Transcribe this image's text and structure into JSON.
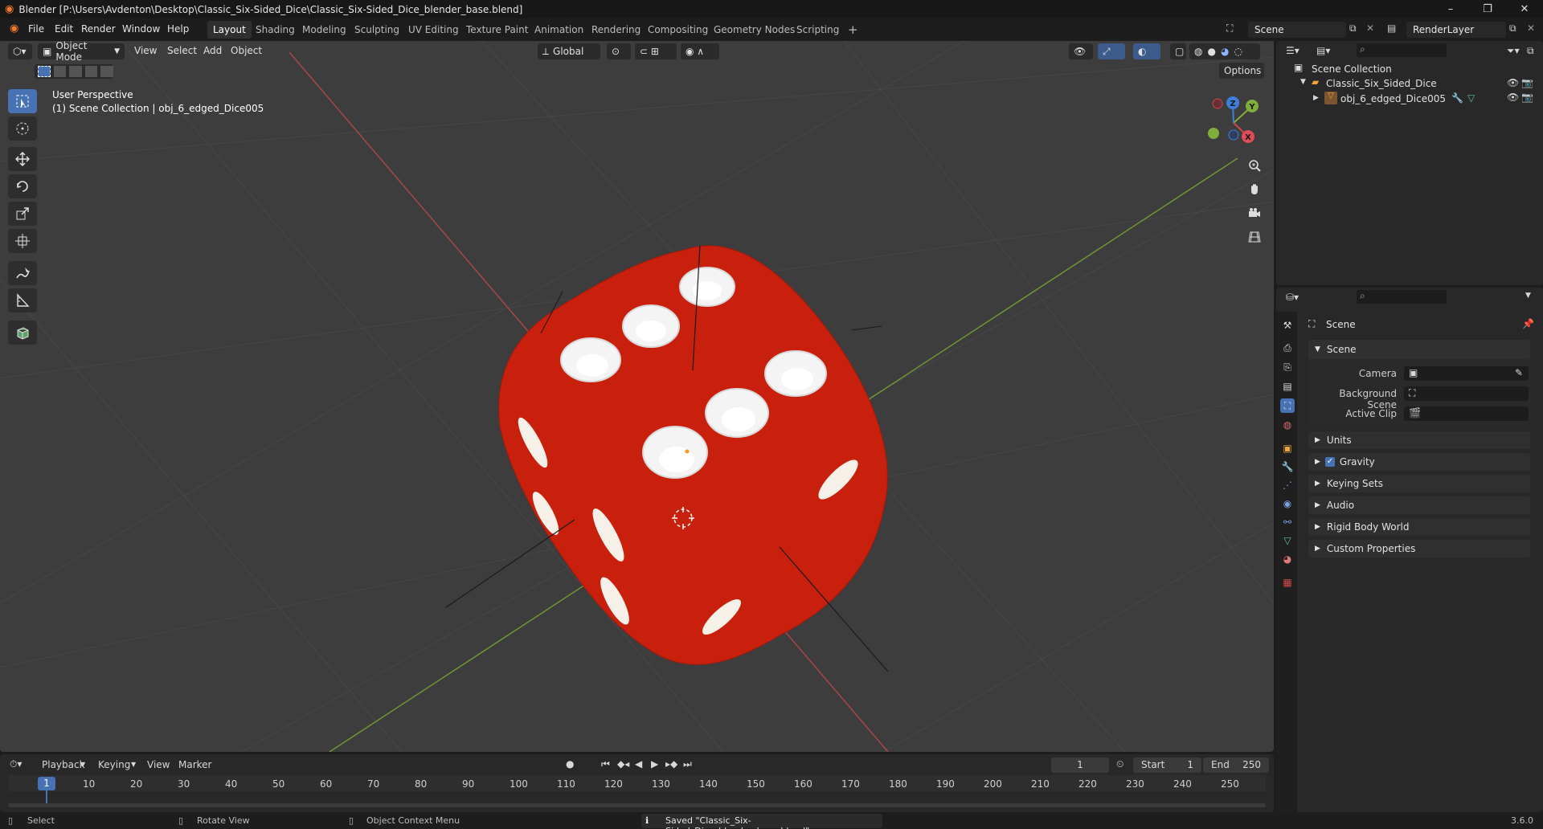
{
  "window": {
    "title": "Blender [P:\\Users\\Avdenton\\Desktop\\Classic_Six-Sided_Dice\\Classic_Six-Sided_Dice_blender_base.blend]"
  },
  "menu": [
    "File",
    "Edit",
    "Render",
    "Window",
    "Help"
  ],
  "workspaces": [
    "Layout",
    "Shading",
    "Modeling",
    "Sculpting",
    "UV Editing",
    "Texture Paint",
    "Animation",
    "Rendering",
    "Compositing",
    "Geometry Nodes",
    "Scripting"
  ],
  "active_workspace": "Layout",
  "topbar_right": {
    "scene": "Scene",
    "view_layer": "RenderLayer"
  },
  "viewport": {
    "mode": "Object Mode",
    "menus": [
      "View",
      "Select",
      "Add",
      "Object"
    ],
    "orientation": "Global",
    "options_label": "Options",
    "info_line1": "User Perspective",
    "info_line2": "(1) Scene Collection | obj_6_edged_Dice005",
    "gizmo_axes": {
      "x": "X",
      "y": "Y",
      "z": "Z"
    }
  },
  "outliner": {
    "root": "Scene Collection",
    "collection": "Classic_Six_Sided_Dice",
    "object": "obj_6_edged_Dice005"
  },
  "properties": {
    "context": "Scene",
    "panel_title": "Scene",
    "fields": {
      "camera": "Camera",
      "background_scene": "Background Scene",
      "active_clip": "Active Clip"
    },
    "subpanels": [
      "Units",
      "Gravity",
      "Keying Sets",
      "Audio",
      "Rigid Body World",
      "Custom Properties"
    ],
    "gravity_checked": true
  },
  "timeline": {
    "menus": [
      "Playback",
      "Keying",
      "View",
      "Marker"
    ],
    "current_frame": "1",
    "start_label": "Start",
    "start": "1",
    "end_label": "End",
    "end": "250",
    "ruler": [
      "10",
      "20",
      "30",
      "40",
      "50",
      "60",
      "70",
      "80",
      "90",
      "100",
      "110",
      "120",
      "130",
      "140",
      "150",
      "160",
      "170",
      "180",
      "190",
      "200",
      "210",
      "220",
      "230",
      "240",
      "250"
    ],
    "playhead": "1"
  },
  "statusbar": {
    "select": "Select",
    "rotate": "Rotate View",
    "context_menu": "Object Context Menu",
    "message": "Saved \"Classic_Six-Sided_Dice_blender_base.blend\"",
    "version": "3.6.0"
  },
  "colors": {
    "dice": "#c9200e",
    "pip": "#f2f2f2",
    "accent": "#4772b3",
    "x_axis": "#c94a4a",
    "y_axis": "#7fae3a",
    "z_axis": "#3f7fdc"
  }
}
